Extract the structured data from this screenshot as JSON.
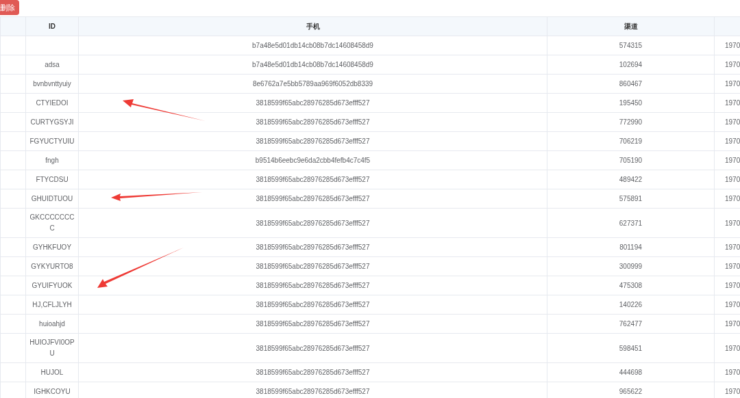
{
  "toolbar": {
    "delete_button": "删除"
  },
  "table": {
    "columns": [
      "",
      "ID",
      "手机",
      "渠道",
      ""
    ],
    "rows": [
      [
        "",
        "",
        "b7a48e5d01db14cb08b7dc14608458d9",
        "574315",
        "1970"
      ],
      [
        "",
        "adsa",
        "b7a48e5d01db14cb08b7dc14608458d9",
        "102694",
        "1970"
      ],
      [
        "",
        "bvnbvnttyuiy",
        "8e6762a7e5bb5789aa969f6052db8339",
        "860467",
        "1970"
      ],
      [
        "",
        "CTYIEDOI",
        "3818599f65abc28976285d673efff527",
        "195450",
        "1970"
      ],
      [
        "",
        "CURTYGSYJI",
        "3818599f65abc28976285d673efff527",
        "772990",
        "1970"
      ],
      [
        "",
        "FGYUCTYUIU",
        "3818599f65abc28976285d673efff527",
        "706219",
        "1970"
      ],
      [
        "",
        "fngh",
        "b9514b6eebc9e6da2cbb4fefb4c7c4f5",
        "705190",
        "1970"
      ],
      [
        "",
        "FTYCDSU",
        "3818599f65abc28976285d673efff527",
        "489422",
        "1970"
      ],
      [
        "",
        "GHUIDTUOU",
        "3818599f65abc28976285d673efff527",
        "575891",
        "1970"
      ],
      [
        "",
        "GKCCCCCCCC",
        "3818599f65abc28976285d673efff527",
        "627371",
        "1970"
      ],
      [
        "",
        "GYHKFUOY",
        "3818599f65abc28976285d673efff527",
        "801194",
        "1970"
      ],
      [
        "",
        "GYKYURTO8",
        "3818599f65abc28976285d673efff527",
        "300999",
        "1970"
      ],
      [
        "",
        "GYUIFYUOK",
        "3818599f65abc28976285d673efff527",
        "475308",
        "1970"
      ],
      [
        "",
        "HJ,CFLJLYH",
        "3818599f65abc28976285d673efff527",
        "140226",
        "1970"
      ],
      [
        "",
        "huioahjd",
        "3818599f65abc28976285d673efff527",
        "762477",
        "1970"
      ],
      [
        "",
        "HUIOJFVI0OPU",
        "3818599f65abc28976285d673efff527",
        "598451",
        "1970"
      ],
      [
        "",
        "HUJOL",
        "3818599f65abc28976285d673efff527",
        "444698",
        "1970"
      ],
      [
        "",
        "IGHKCOYU",
        "3818599f65abc28976285d673efff527",
        "965622",
        "1970"
      ]
    ]
  }
}
